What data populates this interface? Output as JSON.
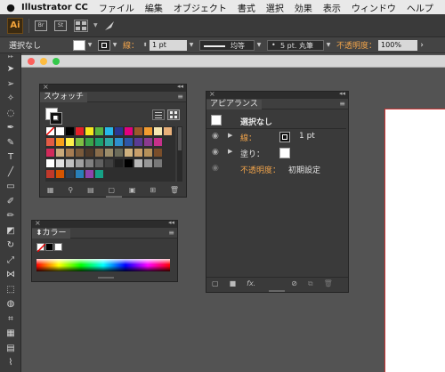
{
  "menubar": {
    "apple": "",
    "app_name": "Illustrator CC",
    "items": [
      "ファイル",
      "編集",
      "オブジェクト",
      "書式",
      "選択",
      "効果",
      "表示",
      "ウィンドウ",
      "ヘルプ"
    ]
  },
  "appbar": {
    "logo": "Ai",
    "bridge": "Br",
    "stock": "St"
  },
  "controlbar": {
    "selection": "選択なし",
    "stroke_label": "線：",
    "stroke_weight": "1 pt",
    "stroke_style": "均等",
    "brush": "5 pt. 丸筆",
    "opacity_label": "不透明度：",
    "opacity_value": "100%"
  },
  "swatches_panel": {
    "title": "スウォッチ",
    "colors_row1": [
      "#ffffff",
      "#000000",
      "#e4222a",
      "#f8e61e",
      "#5ab543",
      "#27b8e8",
      "#2a3691",
      "#e4007f",
      "#9a5a2a",
      "#f29b30",
      "#f7e8b2",
      "#e8b07a"
    ],
    "colors_row2": [
      "#e25b45",
      "#f6a01b",
      "#fff04b",
      "#7fbf43",
      "#3aa349",
      "#1d9f6d",
      "#2fa8a2",
      "#2e8fcd",
      "#2e56a6",
      "#5b3b93",
      "#8b3a8f",
      "#c5308a"
    ],
    "colors_row3": [
      "#d12a5a",
      "#c9a97a",
      "#a67c52",
      "#7a5a3b",
      "#4e3a2a",
      "#8a6d4b",
      "#9c8d6a",
      "#6c6c5a",
      "#d0b27f",
      "#c89f6a",
      "#b6915a",
      "#7a4e2a"
    ],
    "colors_row4": [
      "#ffffff",
      "#e0e0e0",
      "#c0c0c0",
      "#a0a0a0",
      "#808080",
      "#606060",
      "#404040",
      "#202020",
      "#000000",
      "#b8b8b8",
      "#989898",
      "#787878"
    ],
    "colors_row5": [
      "#c0392b",
      "#d35400",
      "#2c3e50",
      "#2980b9",
      "#8e44ad",
      "#16a085"
    ]
  },
  "color_panel": {
    "title": "カラー"
  },
  "appearance_panel": {
    "title": "アピアランス",
    "header": "選択なし",
    "rows": [
      {
        "label": "線：",
        "value": "1 pt"
      },
      {
        "label": "塗り：",
        "value": ""
      },
      {
        "label": "不透明度：",
        "value": "初期設定"
      }
    ],
    "fx": "fx."
  }
}
